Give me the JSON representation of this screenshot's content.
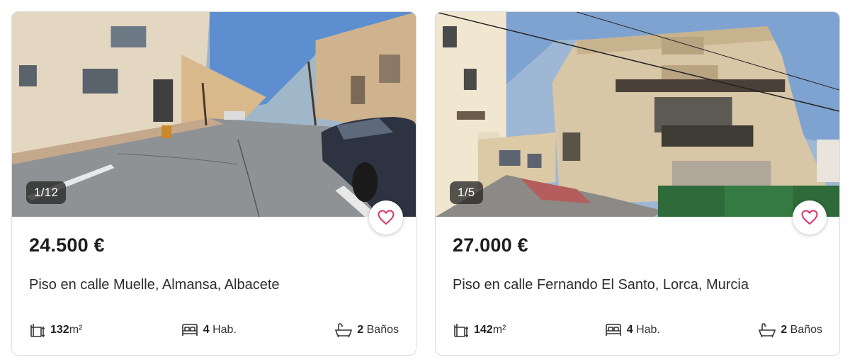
{
  "listings": [
    {
      "photo_counter": "1/12",
      "price": "24.500 €",
      "title": "Piso en calle Muelle, Almansa, Albacete",
      "area_value": "132",
      "area_unit": "m²",
      "rooms_value": "4",
      "rooms_unit": "Hab.",
      "baths_value": "2",
      "baths_unit": "Baños"
    },
    {
      "photo_counter": "1/5",
      "price": "27.000 €",
      "title": "Piso en calle Fernando El Santo, Lorca, Murcia",
      "area_value": "142",
      "area_unit": "m²",
      "rooms_value": "4",
      "rooms_unit": "Hab.",
      "baths_value": "2",
      "baths_unit": "Baños"
    }
  ],
  "colors": {
    "heart": "#d6336c",
    "counter_bg": "#2a2a2a",
    "card_border": "#dcdcdc"
  },
  "icons": [
    "area-icon",
    "bed-icon",
    "bath-icon",
    "heart-icon"
  ]
}
